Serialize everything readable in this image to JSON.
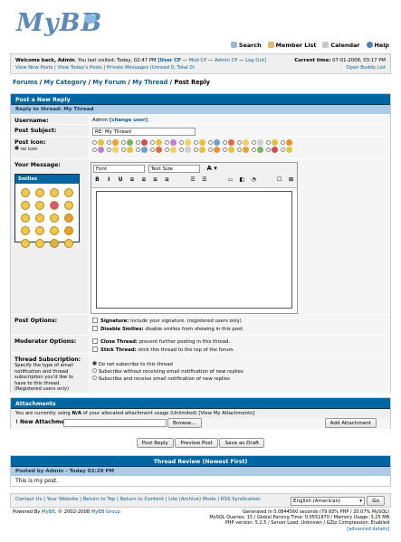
{
  "brand": {
    "logo": "MyBB"
  },
  "toplinks": [
    "Search",
    "Member List",
    "Calendar",
    "Help"
  ],
  "welcome": {
    "line1_a": "Welcome back, ",
    "user": "Admin",
    "line1_b": ". You last visited: Today, 02:47 PM ",
    "user_cp": "[User CP",
    "mod_cp": "Mod CP",
    "admin_cp": "Admin CP",
    "logout": "Log Out]",
    "line2": "View New Posts | View Today's Posts | Private Messages (Unread 0, Total 0)",
    "time_label": "Current time:",
    "time": "07-01-2008, 03:17 PM",
    "buddy": "Open Buddy List"
  },
  "breadcrumb": [
    "Forums",
    "My Category",
    "My Forum",
    "My Thread",
    "Post Reply"
  ],
  "reply": {
    "title": "Post a New Reply",
    "subtitle": "Reply to thread: My Thread",
    "username_label": "Username:",
    "username": "Admin",
    "change_user": "[change user]",
    "subject_label": "Post Subject:",
    "subject": "RE: My Thread",
    "icon_label": "Post Icon:",
    "no_icon": "no icon",
    "message_label": "Your Message:",
    "smilies_title": "Smilies",
    "font": "Font",
    "size": "Text Size"
  },
  "options": {
    "post_label": "Post Options:",
    "sig_bold": "Signature:",
    "sig": " include your signature. (registered users only)",
    "dis_bold": "Disable Smilies:",
    "dis": " disable smilies from showing in this post.",
    "mod_label": "Moderator Options:",
    "close_bold": "Close Thread:",
    "close": " prevent further posting in this thread.",
    "stick_bold": "Stick Thread:",
    "stick": " stick this thread to the top of the forum.",
    "sub_label": "Thread Subscription:",
    "sub_desc": "Specify the type of email notification and thread subscription you'd like to have to this thread. (Registered users only)",
    "sub_opts": [
      "Do not subscribe to this thread",
      "Subscribe without receiving email notification of new replies",
      "Subscribe and receive email notification of new replies"
    ]
  },
  "attach": {
    "title": "Attachments",
    "usage_a": "You are currently using ",
    "usage_b": "N/A",
    "usage_c": " of your allocated attachment usage (Unlimited) [View My Attachments]",
    "new_label": "New Attachment:",
    "browse": "Browse...",
    "add": "Add Attachment"
  },
  "buttons": {
    "post": "Post Reply",
    "preview": "Preview Post",
    "draft": "Save as Draft"
  },
  "review": {
    "title": "Thread Review (Newest First)",
    "by": "Posted by Admin - Today 02:29 PM",
    "body": "This is my post."
  },
  "footer": {
    "links": "Contact Us | Your Website | Return to Top | Return to Content | Lite (Archive) Mode | RSS Syndication",
    "lang": "English (American)",
    "go": "Go",
    "powered_a": "Powered By ",
    "powered_b": "MyBB",
    "powered_c": ", © 2002-2008 ",
    "powered_d": "MyBB Group",
    "stats1": "Generated in 0.0844560 seconds (79.93% PHP / 20.07% MySQL)",
    "stats2": "MySQL Queries: 15 / Global Parsing Time: 0.0551870 / Memory Usage: 3.25 MB",
    "stats3": "PHP version: 5.2.5 / Server Load: Unknown / GZip Compression: Enabled",
    "adv": "[advanced details]"
  }
}
